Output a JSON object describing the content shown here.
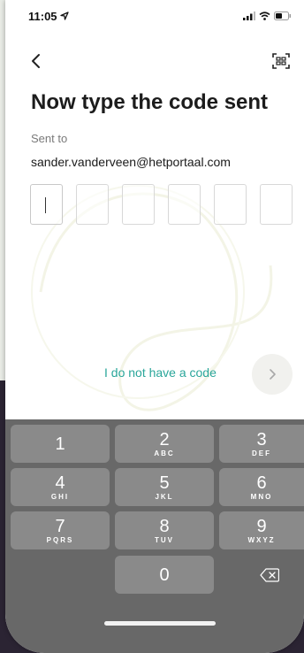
{
  "status": {
    "time": "11:05"
  },
  "header": {
    "title": "Now type the code sent"
  },
  "recipient": {
    "label": "Sent to",
    "email": "sander.vanderveen@hetportaal.com"
  },
  "code": {
    "boxes": [
      "",
      "",
      "",
      "",
      "",
      ""
    ]
  },
  "actions": {
    "no_code_label": "I do not have a code"
  },
  "keyboard": {
    "keys": [
      {
        "num": "1",
        "letters": ""
      },
      {
        "num": "2",
        "letters": "ABC"
      },
      {
        "num": "3",
        "letters": "DEF"
      },
      {
        "num": "4",
        "letters": "GHI"
      },
      {
        "num": "5",
        "letters": "JKL"
      },
      {
        "num": "6",
        "letters": "MNO"
      },
      {
        "num": "7",
        "letters": "PQRS"
      },
      {
        "num": "8",
        "letters": "TUV"
      },
      {
        "num": "9",
        "letters": "WXYZ"
      },
      {
        "num": "0",
        "letters": ""
      }
    ],
    "delete_icon": "backspace-icon"
  },
  "colors": {
    "accent": "#2aa69a",
    "keyboard_bg": "#686868",
    "key_bg": "#8a8a8a"
  }
}
